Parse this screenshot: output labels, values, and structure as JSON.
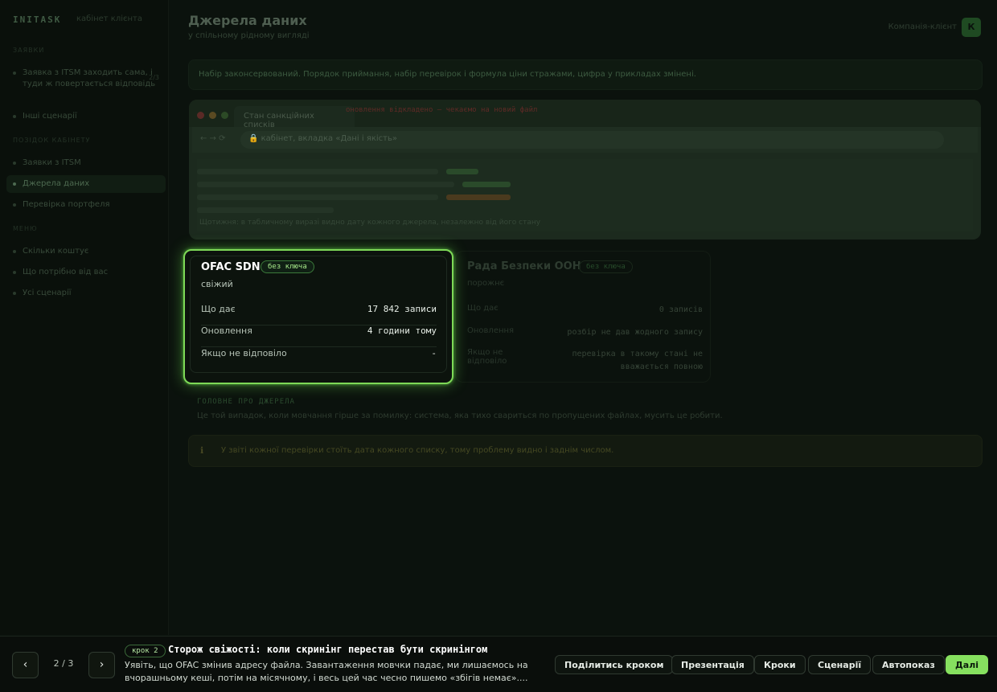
{
  "app": {
    "brand": "INITASK",
    "brand_sub": "кабінет клієнта"
  },
  "sidebar": {
    "sections": [
      {
        "title": "ЗАЯВКИ"
      },
      {
        "title": "ПОЗІДОК КАБІНЕТУ"
      },
      {
        "title": "МЕНЮ"
      }
    ],
    "items": [
      {
        "label": "Заявка з ITSM заходить сама, і туди ж повертається відповідь",
        "badge": "2/3"
      },
      {
        "label": "Інші сценарії"
      },
      {
        "label": "Заявки з ITSM"
      },
      {
        "label": "Джерела даних"
      },
      {
        "label": "Перевірка портфеля"
      },
      {
        "label": "Скільки коштує"
      },
      {
        "label": "Що потрібно від вас"
      },
      {
        "label": "Усі сценарії"
      }
    ]
  },
  "header": {
    "title": "Джерела даних",
    "subtitle": "у спільному рідному вигляді",
    "user": "Компанія-клієнт",
    "avatar": "К"
  },
  "info_bar": {
    "text": "Набір законсервований. Порядок приймання, набір перевірок і формула ціни стражами, цифра у прикладах змінені."
  },
  "browser": {
    "tab": "Стан санкційних списків",
    "url": "🔒 кабінет, вкладка «Дані і якість»",
    "warn_line": "оновлення відкладено — чекаємо на новий файл",
    "note": "Щотижня: в табличному виразі видно дату кожного джерела, незалежно від його стану"
  },
  "cards": [
    {
      "name": "OFAC SDN",
      "badge": "без ключа",
      "status": "свіжий",
      "rows": [
        {
          "label": "Що дає",
          "value": "17 842 записи"
        },
        {
          "label": "Оновлення",
          "value": "4 години тому"
        },
        {
          "label": "Якщо не відповіло",
          "value": "-"
        }
      ]
    },
    {
      "name": "Рада Безпеки ООН",
      "badge": "без ключа",
      "status": "порожнє",
      "rows": [
        {
          "label": "Що дає",
          "value": "0 записів"
        },
        {
          "label": "Оновлення",
          "value": "розбір не дав жодного запису"
        },
        {
          "label": "Якщо не відповіло",
          "value": "перевірка в такому стані не вважається повною"
        }
      ]
    }
  ],
  "footer": {
    "heading": "ГОЛОВНЕ ПРО ДЖЕРЕЛА",
    "text": "Це той випадок, коли мовчання гірше за помилку: система, яка тихо свариться по пропущених файлах, мусить це робити.",
    "warning": "У звіті кожної перевірки стоїть дата кожного списку, тому проблему видно і заднім числом."
  },
  "bottom": {
    "counter": "2 / 3",
    "step_badge": "крок 2",
    "step_title": "Сторож свіжості: коли скринінг перестав бути скринінгом",
    "step_desc": "Уявіть, що OFAC змінив адресу файла. Завантаження мовчки падає, ми лишаємось на вчорашньому кеші, потім на місячному, і весь цей час чесно пишемо «збігів немає»....",
    "buttons": {
      "share": "Поділитись кроком",
      "present": "Презентація",
      "steps": "Кроки",
      "scenarios": "Сценарії",
      "autoplay": "Автопоказ",
      "next": "Далі"
    }
  },
  "colors": {
    "accent": "#86e05f",
    "highlight_border": "#7ed957",
    "background": "#0b120d"
  }
}
